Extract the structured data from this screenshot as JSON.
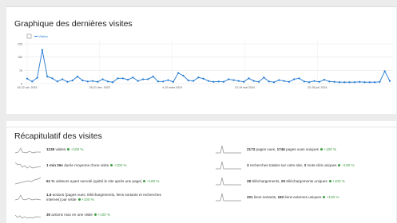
{
  "visits_graph": {
    "title": "Graphique des dernières visites",
    "legend_label": "Visites",
    "legend_color": "#1f78d1"
  },
  "chart_data": {
    "type": "line",
    "title": "Graphique des dernières visites",
    "y_ticks": [
      "225",
      "150",
      "75",
      "0"
    ],
    "ylim": [
      0,
      225
    ],
    "x_tick_labels": [
      "16-22 oct. 2023",
      "25-31 déc. 2023",
      "4-10 mars 2024",
      "13-19 mai 2024",
      "22-28 juil. 2024"
    ],
    "grid": true,
    "legend": "top-left",
    "series": [
      {
        "name": "Visites",
        "color": "#1f78d1",
        "values": [
          28,
          12,
          33,
          190,
          40,
          30,
          12,
          25,
          10,
          18,
          40,
          18,
          12,
          15,
          10,
          25,
          12,
          8,
          30,
          30,
          22,
          35,
          15,
          25,
          25,
          40,
          12,
          12,
          20,
          10,
          60,
          45,
          18,
          15,
          35,
          28,
          15,
          10,
          12,
          10,
          25,
          20,
          15,
          10,
          30,
          15,
          10,
          35,
          12,
          8,
          20,
          15,
          10,
          25,
          30,
          12,
          8,
          15,
          10,
          22,
          12,
          10,
          8,
          8,
          8,
          8,
          10,
          8,
          8,
          8,
          10,
          70,
          15
        ]
      }
    ]
  },
  "summary": {
    "title": "Récapitulatif des visites",
    "change_label": "+100 %",
    "left": [
      {
        "num1": "1235",
        "text1": " visites"
      },
      {
        "num1": "1 min 26s",
        "text1": " durée moyenne d'une visite"
      },
      {
        "num1": "61 %",
        "text1": " visiteurs ayant survolé (quitté le site après une page)"
      },
      {
        "num1": "1,9",
        "text1": " actions (pages vues, téléchargements, liens sortants et recherches",
        "line2": "internes) par visite"
      },
      {
        "num1": "30",
        "text1": " actions max en une visite"
      }
    ],
    "right": [
      {
        "num1": "2173",
        "text1": " pages vues, ",
        "num2": "1746",
        "text2": " pages vues uniques"
      },
      {
        "num1": "3",
        "text1": " recherches totales sur votre site, ",
        "num2": "3",
        "text2": " mots-clés uniques"
      },
      {
        "num1": "28",
        "text1": " téléchargements, ",
        "num2": "25",
        "text2": " téléchargements uniques"
      },
      {
        "num1": "201",
        "text1": " liens sortants, ",
        "num2": "182",
        "text2": " liens externes uniques"
      }
    ]
  }
}
